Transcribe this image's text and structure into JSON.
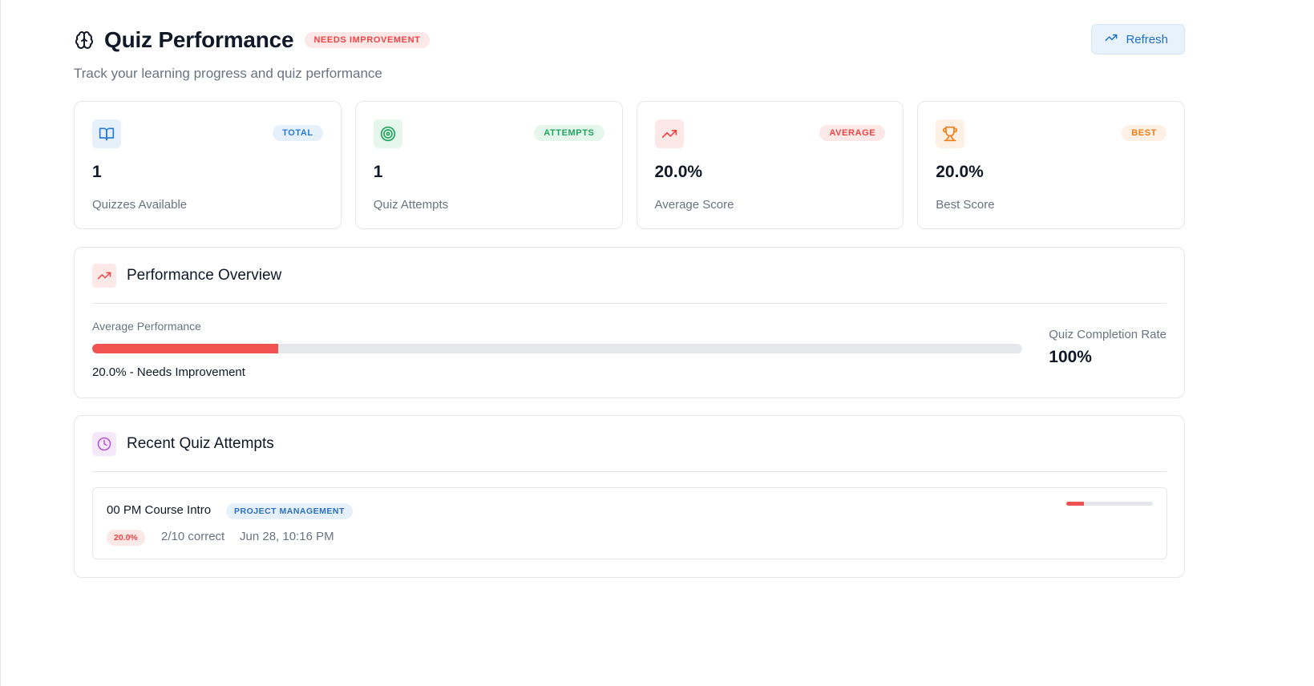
{
  "header": {
    "title": "Quiz Performance",
    "status_badge": "NEEDS IMPROVEMENT",
    "subtitle": "Track your learning progress and quiz performance",
    "refresh_label": "Refresh"
  },
  "stats": [
    {
      "icon": "book-icon",
      "badge": "TOTAL",
      "value": "1",
      "label": "Quizzes Available",
      "color": "#2b7bd6",
      "bg": "#e6f0fb"
    },
    {
      "icon": "target-icon",
      "badge": "ATTEMPTS",
      "value": "1",
      "label": "Quiz Attempts",
      "color": "#22a45d",
      "bg": "#e5f6ec"
    },
    {
      "icon": "trending-up-icon",
      "badge": "AVERAGE",
      "value": "20.0%",
      "label": "Average Score",
      "color": "#ef4444",
      "bg": "#fde8e8"
    },
    {
      "icon": "trophy-icon",
      "badge": "BEST",
      "value": "20.0%",
      "label": "Best Score",
      "color": "#f07c1a",
      "bg": "#fef0e4"
    }
  ],
  "performance": {
    "title": "Performance Overview",
    "avg_label": "Average Performance",
    "avg_fraction": 0.2,
    "avg_text": "20.0% - Needs Improvement",
    "completion_label": "Quiz Completion Rate",
    "completion_value": "100%"
  },
  "recent": {
    "title": "Recent Quiz Attempts",
    "attempts": [
      {
        "title": "00 PM Course Intro",
        "category": "PROJECT MANAGEMENT",
        "score": "20.0%",
        "score_fraction": 0.2,
        "correct": "2/10 correct",
        "date": "Jun 28, 10:16 PM"
      }
    ]
  },
  "colors": {
    "accent_blue": "#1f6fd1",
    "danger": "#ef4444",
    "purple": "#b44fd6"
  }
}
